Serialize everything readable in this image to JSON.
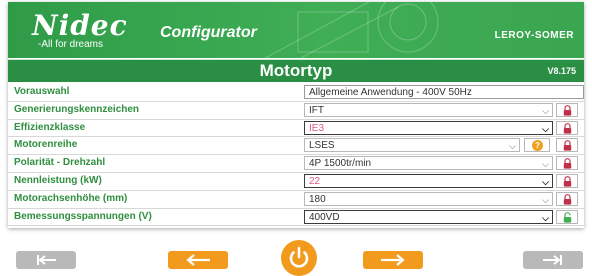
{
  "header": {
    "logo": "Nidec",
    "tagline": "-All for dreams",
    "app_title": "Configurator",
    "brand": "LEROY-SOMER"
  },
  "titlebar": {
    "title": "Motortyp",
    "version": "V8.175"
  },
  "rows": [
    {
      "label": "Vorauswahl",
      "value": "Allgemeine Anwendung - 400V 50Hz",
      "kind": "text"
    },
    {
      "label": "Generierungskennzeichen",
      "value": "IFT",
      "kind": "select",
      "lock": "red"
    },
    {
      "label": "Effizienzklasse",
      "value": "IE3",
      "kind": "select",
      "lock": "red",
      "error": true,
      "active": true
    },
    {
      "label": "Motorenreihe",
      "value": "LSES",
      "kind": "select",
      "lock": "red",
      "help": true
    },
    {
      "label": "Polarität - Drehzahl",
      "value": "4P 1500tr/min",
      "kind": "select",
      "lock": "red"
    },
    {
      "label": "Nennleistung (kW)",
      "value": "22",
      "kind": "select",
      "lock": "red",
      "error": true,
      "active": true
    },
    {
      "label": "Motorachsenhöhe (mm)",
      "value": "180",
      "kind": "select",
      "lock": "red"
    },
    {
      "label": "Bemessungsspannungen (V)",
      "value": "400VD",
      "kind": "select",
      "lock": "green",
      "active": true
    }
  ],
  "icons": {
    "help": "?",
    "lock_closed": "lock-icon",
    "lock_open": "unlock-icon"
  },
  "nav": {
    "first": "first-page-icon",
    "prev": "arrow-left-icon",
    "power": "power-icon",
    "next": "arrow-right-icon",
    "last": "last-page-icon"
  },
  "colors": {
    "brand_green": "#3aa650",
    "title_green": "#2a8f45",
    "label_green": "#2f8f3f",
    "orange": "#f29a1c",
    "error_pink": "#e05a80",
    "lock_red": "#c0304a",
    "lock_green": "#3fae55"
  }
}
